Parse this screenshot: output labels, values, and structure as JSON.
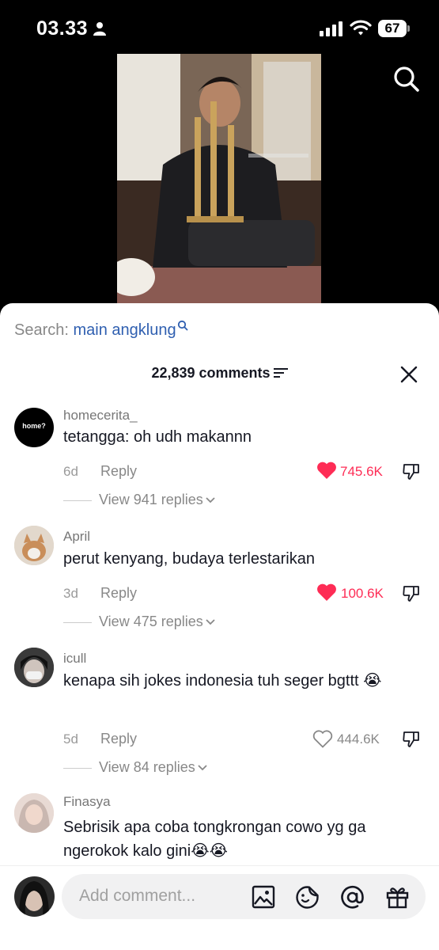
{
  "status": {
    "time": "03.33",
    "battery": "67"
  },
  "search": {
    "label": "Search:",
    "keyword": "main angklung"
  },
  "header": {
    "count_label": "22,839 comments"
  },
  "comments": [
    {
      "user": "homecerita_",
      "avatar_text": "home?",
      "text": "tetangga: oh udh makannn",
      "age": "6d",
      "reply": "Reply",
      "likes": "745.6K",
      "liked": true,
      "view_replies": "View 941 replies"
    },
    {
      "user": "April",
      "text": "perut kenyang, budaya terlestarikan",
      "age": "3d",
      "reply": "Reply",
      "likes": "100.6K",
      "liked": true,
      "view_replies": "View 475 replies"
    },
    {
      "user": "icull",
      "text": "kenapa sih jokes indonesia tuh seger bgttt 😭",
      "age": "5d",
      "reply": "Reply",
      "likes": "444.6K",
      "liked": false,
      "view_replies": "View 84 replies"
    },
    {
      "user": "Finasya",
      "text": "Sebrisik apa coba tongkrongan cowo yg ga ngerokok kalo gini😭😭"
    }
  ],
  "composer": {
    "placeholder": "Add comment..."
  },
  "colors": {
    "accent_blue": "#2f5fb0",
    "like_red": "#fe2c55",
    "text_dark": "#161823"
  },
  "icons": [
    "person-icon",
    "signal-icon",
    "wifi-icon",
    "search-icon",
    "filter-icon",
    "close-icon",
    "heart-icon",
    "dislike-icon",
    "chevron-down-icon",
    "image-icon",
    "emoji-icon",
    "mention-icon",
    "gift-icon"
  ]
}
